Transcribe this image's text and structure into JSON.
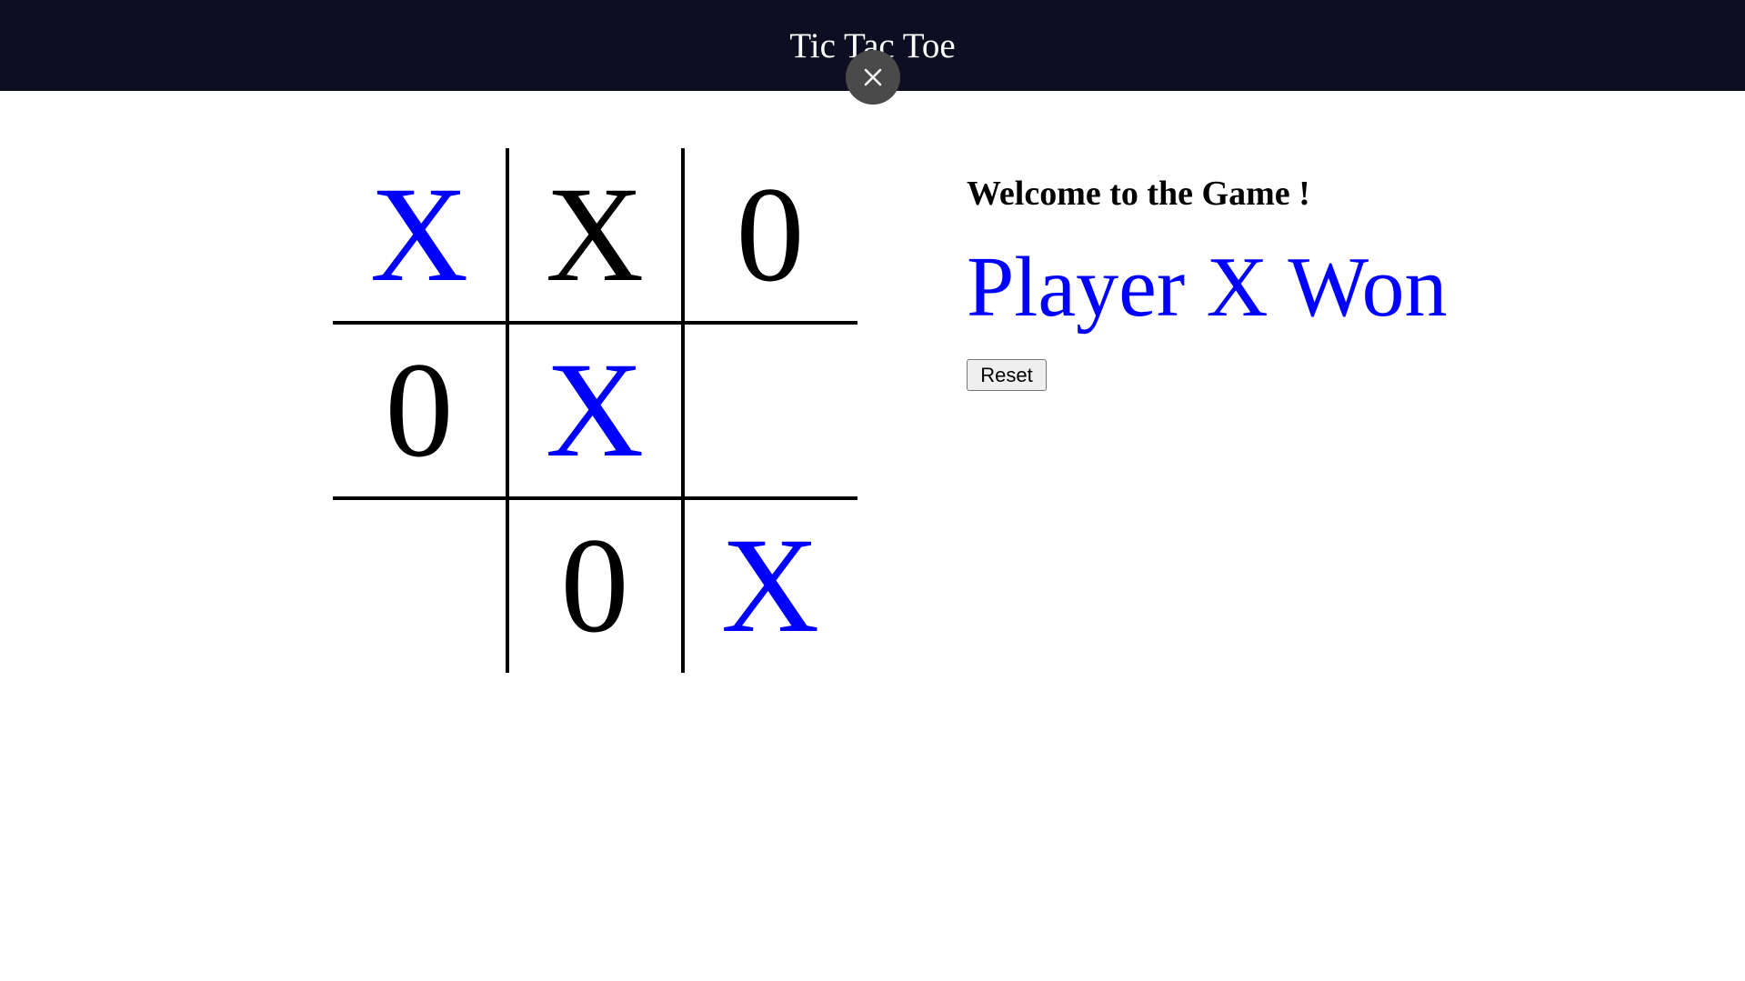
{
  "header": {
    "title": "Tic Tac Toe",
    "background": "#0e0e22",
    "close_icon": "close-icon"
  },
  "board": {
    "cells": [
      {
        "mark": "X",
        "color": "#0000ff"
      },
      {
        "mark": "X",
        "color": "#000000"
      },
      {
        "mark": "0",
        "color": "#000000"
      },
      {
        "mark": "0",
        "color": "#000000"
      },
      {
        "mark": "X",
        "color": "#0000ff"
      },
      {
        "mark": "",
        "color": "#000000"
      },
      {
        "mark": "",
        "color": "#000000"
      },
      {
        "mark": "0",
        "color": "#000000"
      },
      {
        "mark": "X",
        "color": "#0000ff"
      }
    ]
  },
  "info": {
    "welcome": "Welcome to the Game !",
    "status": "Player X Won",
    "status_color": "#0000ff",
    "reset_label": "Reset"
  }
}
